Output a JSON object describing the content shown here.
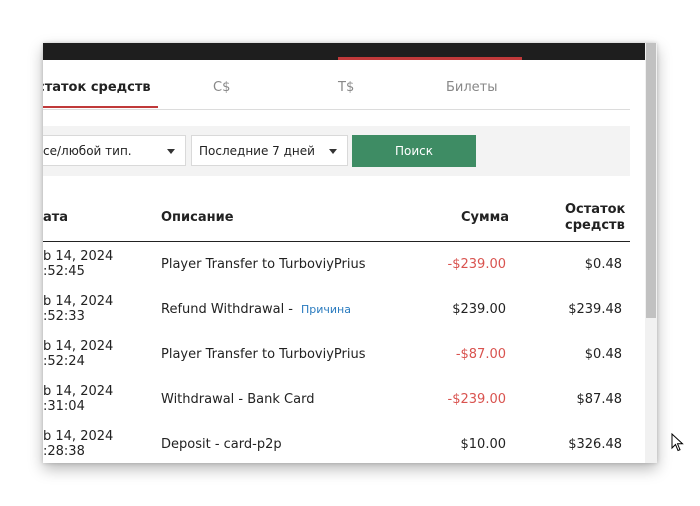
{
  "tabs": {
    "balance": "статок средств",
    "cdollar": "C$",
    "tdollar": "T$",
    "tickets": "Билеты"
  },
  "filters": {
    "type_value": "се/любой тип.",
    "period_value": "Последние 7 дней",
    "search_label": "Поиск"
  },
  "table": {
    "headers": {
      "date": "ата",
      "description": "Описание",
      "amount": "Сумма",
      "balance_line1": "Остаток",
      "balance_line2": "средств"
    },
    "rows": [
      {
        "date1": "b 14, 2024",
        "date2": ":52:45",
        "description": "Player Transfer to TurboviyPrius",
        "reason": "",
        "amount": "-$239.00",
        "negative": true,
        "balance": "$0.48"
      },
      {
        "date1": "b 14, 2024",
        "date2": ":52:33",
        "description": "Refund Withdrawal -",
        "reason": "Причина",
        "amount": "$239.00",
        "negative": false,
        "balance": "$239.48"
      },
      {
        "date1": "b 14, 2024",
        "date2": ":52:24",
        "description": "Player Transfer to TurboviyPrius",
        "reason": "",
        "amount": "-$87.00",
        "negative": true,
        "balance": "$0.48"
      },
      {
        "date1": "b 14, 2024",
        "date2": ":31:04",
        "description": "Withdrawal - Bank Card",
        "reason": "",
        "amount": "-$239.00",
        "negative": true,
        "balance": "$87.48"
      },
      {
        "date1": "b 14, 2024",
        "date2": ":28:38",
        "description": "Deposit - card-p2p",
        "reason": "",
        "amount": "$10.00",
        "negative": false,
        "balance": "$326.48"
      }
    ]
  },
  "colors": {
    "accent_red": "#c0393a",
    "negative_amount": "#d9534f",
    "search_button": "#3e8c64",
    "link_blue": "#2a7bbf"
  }
}
